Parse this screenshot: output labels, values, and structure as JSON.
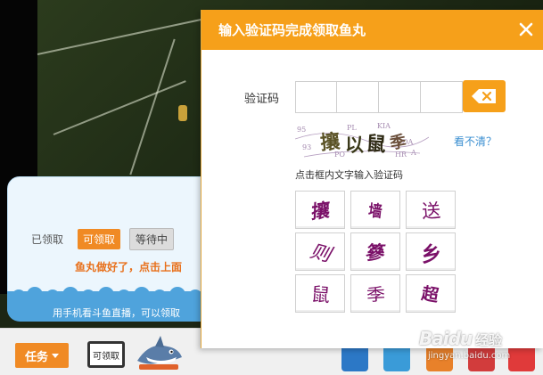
{
  "dialog": {
    "title": "输入验证码完成领取鱼丸",
    "code_label": "验证码",
    "refresh_link": "看不清？",
    "instruction": "点击框内文字输入验证码",
    "characters": [
      "攘",
      "墙",
      "送",
      "则",
      "篸",
      "乡",
      "鼠",
      "季",
      "超"
    ]
  },
  "claim_panel": {
    "tabs": [
      "已领取",
      "可领取",
      "等待中"
    ],
    "tip": "鱼丸做好了，点击上面",
    "footer": "用手机看斗鱼直播，可以领取"
  },
  "bottom_bar": {
    "task_label": "任务",
    "tv_label": "可领取"
  },
  "watermark": {
    "brand": "Baidu",
    "brand_cn": "经验",
    "domain": "jingyan.baidu.com"
  },
  "colors": {
    "accent": "#f6a01a",
    "task_orange": "#f08a24",
    "link_blue": "#3b8fd1",
    "glyph_purple": "#7a1068"
  }
}
